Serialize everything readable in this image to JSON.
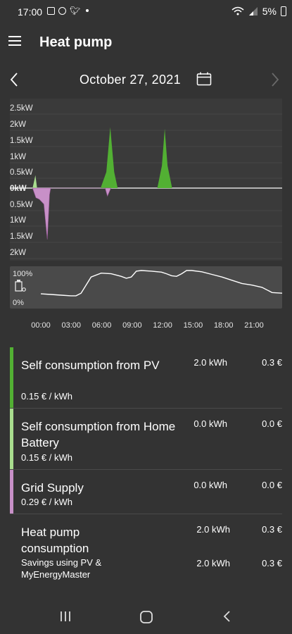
{
  "status": {
    "time": "17:00",
    "battery": "5%"
  },
  "appbar": {
    "title": "Heat pump"
  },
  "datebar": {
    "date": "October 27, 2021"
  },
  "power_chart": {
    "labels": [
      "2.5kW",
      "2kW",
      "1.5kW",
      "1kW",
      "0.5kW",
      "0kW",
      "0.5kW",
      "1kW",
      "1.5kW",
      "2kW"
    ],
    "colors": {
      "pv": "#52b033",
      "battery": "#a8dd8e",
      "grid": "#c890c8",
      "grid_dark": "#9a5a9a"
    }
  },
  "soc_chart": {
    "labels": [
      "100%",
      "0%"
    ]
  },
  "chart_data": {
    "type": "area",
    "x_ticks": [
      "00:00",
      "03:00",
      "06:00",
      "09:00",
      "12:00",
      "15:00",
      "18:00",
      "21:00"
    ],
    "ylabel_ticks": [
      "2.5kW",
      "2kW",
      "1.5kW",
      "1kW",
      "0.5kW",
      "0kW",
      "0.5kW",
      "1kW",
      "1.5kW",
      "2kW"
    ],
    "ylim": [
      -2.0,
      2.5
    ],
    "series": [
      {
        "name": "Self consumption from PV",
        "points": [
          [
            8.0,
            0
          ],
          [
            8.5,
            0.5
          ],
          [
            8.85,
            1.9
          ],
          [
            9.2,
            0.5
          ],
          [
            9.5,
            0
          ],
          [
            13.0,
            0
          ],
          [
            13.4,
            0.7
          ],
          [
            13.65,
            1.85
          ],
          [
            13.9,
            0.7
          ],
          [
            14.3,
            0
          ]
        ]
      },
      {
        "name": "Self consumption from Home Battery",
        "points": [
          [
            2.0,
            0
          ],
          [
            2.25,
            0.4
          ],
          [
            2.4,
            0
          ]
        ]
      },
      {
        "name": "Grid Supply",
        "points": [
          [
            2.0,
            0
          ],
          [
            2.3,
            -0.3
          ],
          [
            2.6,
            -0.35
          ],
          [
            3.0,
            -0.5
          ],
          [
            3.3,
            -1.6
          ],
          [
            3.5,
            -0.2
          ],
          [
            3.6,
            0
          ],
          [
            8.4,
            0
          ],
          [
            8.6,
            -0.25
          ],
          [
            8.9,
            0
          ]
        ]
      }
    ],
    "soc": {
      "ylim": [
        0,
        100
      ],
      "points": [
        [
          0,
          28
        ],
        [
          1,
          26
        ],
        [
          2,
          24
        ],
        [
          3,
          22
        ],
        [
          3.5,
          22
        ],
        [
          4,
          30
        ],
        [
          5,
          80
        ],
        [
          6,
          92
        ],
        [
          7,
          90
        ],
        [
          8,
          82
        ],
        [
          8.5,
          76
        ],
        [
          9,
          80
        ],
        [
          9.5,
          98
        ],
        [
          10,
          100
        ],
        [
          11,
          98
        ],
        [
          12,
          95
        ],
        [
          12.5,
          90
        ],
        [
          13,
          84
        ],
        [
          13.5,
          82
        ],
        [
          14,
          90
        ],
        [
          14.5,
          100
        ],
        [
          15,
          100
        ],
        [
          16,
          96
        ],
        [
          17,
          88
        ],
        [
          18,
          80
        ],
        [
          19,
          70
        ],
        [
          20,
          60
        ],
        [
          21,
          55
        ],
        [
          22,
          48
        ],
        [
          23,
          32
        ],
        [
          24,
          30
        ]
      ]
    }
  },
  "rows": [
    {
      "name": "Self consumption from PV",
      "price": "0.15 € / kWh",
      "kwh": "2.0 kWh",
      "cost": "0.3 €",
      "color": "#52b033"
    },
    {
      "name": "Self consumption from Home Battery",
      "price": "0.15 € / kWh",
      "kwh": "0.0 kWh",
      "cost": "0.0 €",
      "color": "#a8dd8e"
    },
    {
      "name": "Grid Supply",
      "price": "0.29 € / kWh",
      "kwh": "0.0 kWh",
      "cost": "0.0 €",
      "color": "#c890c8"
    }
  ],
  "total": {
    "name": "Heat pump consumption",
    "kwh": "2.0 kWh",
    "cost": "0.3 €",
    "savings_label": "Savings using PV & MyEnergyMaster",
    "savings_kwh": "2.0 kWh",
    "savings_cost": "0.3 €"
  },
  "icons": {
    "menu": "menu-icon",
    "prev": "chevron-left-icon",
    "next": "chevron-right-icon",
    "calendar": "calendar-icon"
  }
}
